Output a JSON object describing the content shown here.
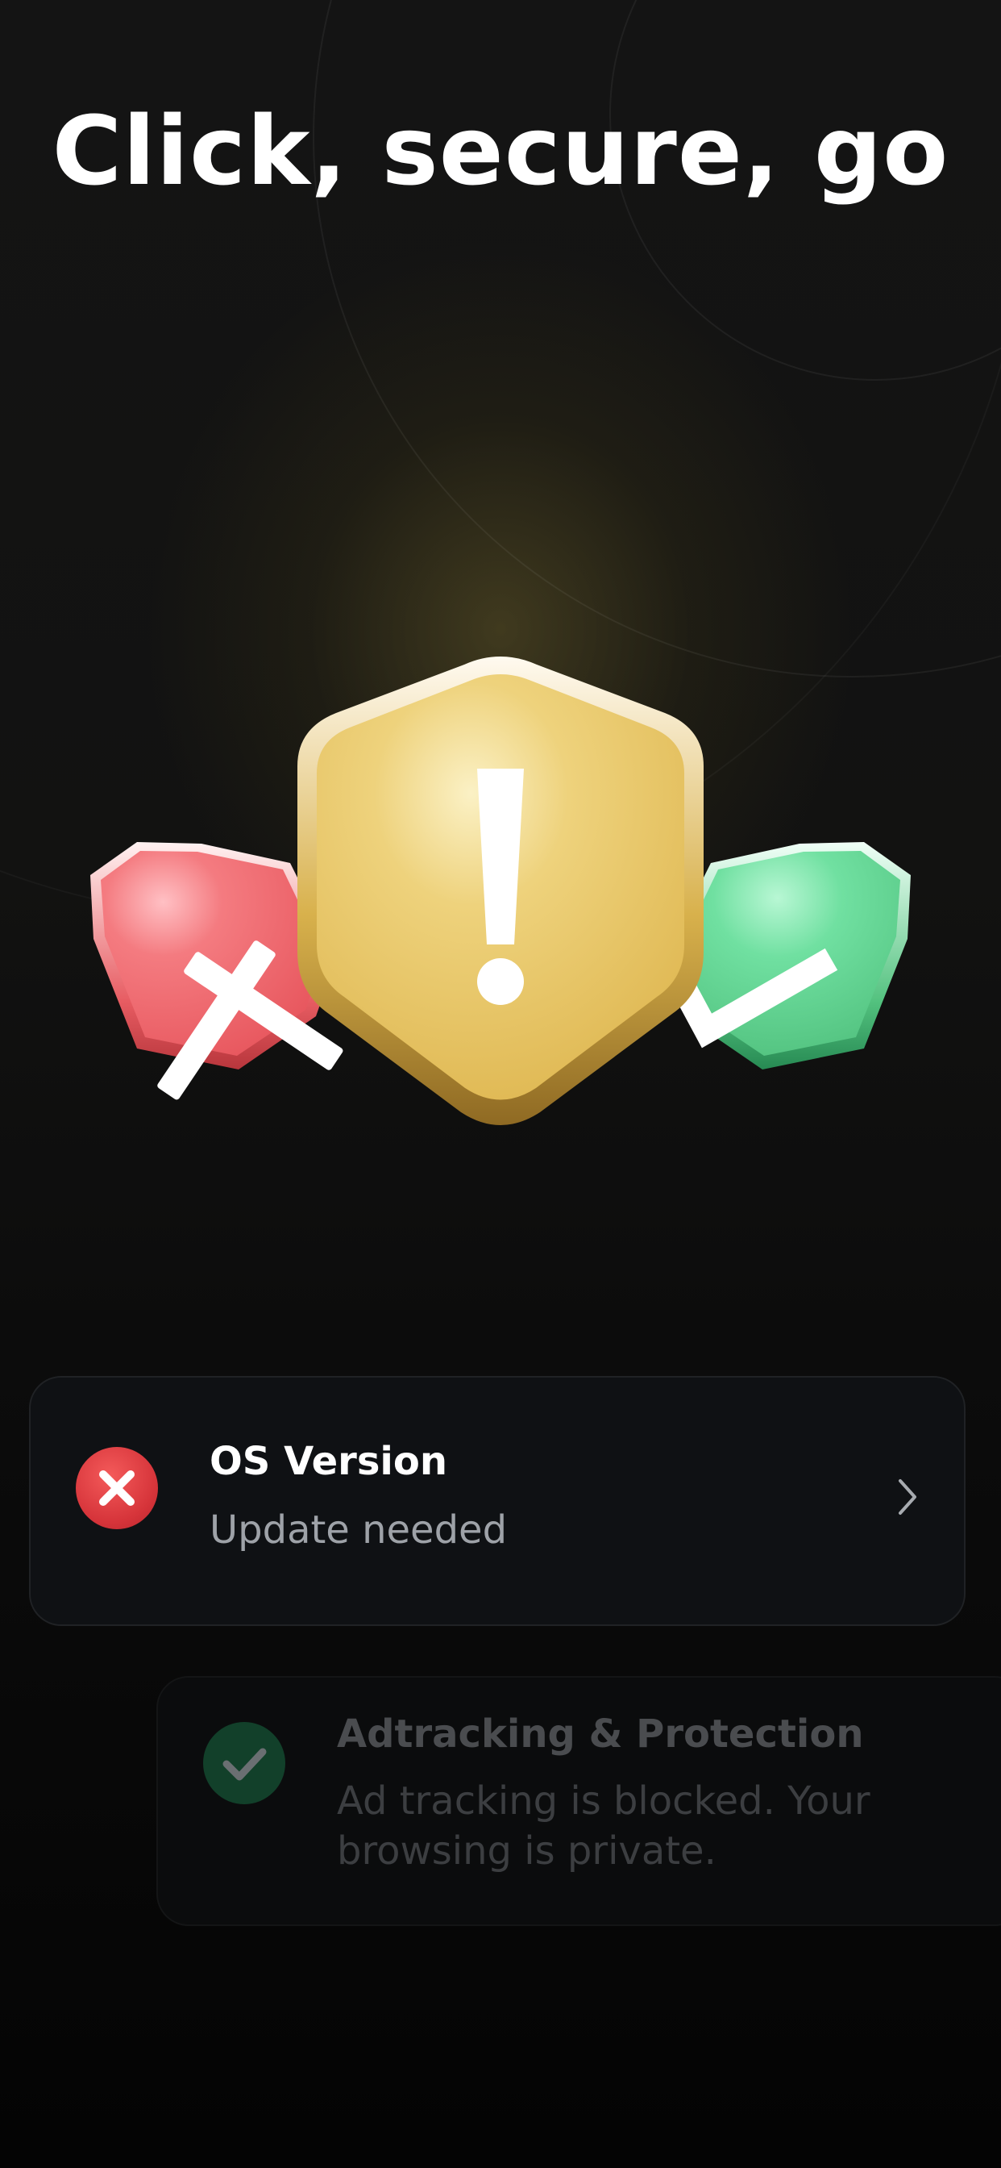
{
  "hero": {
    "title": "Click, secure, go"
  },
  "illustration": {
    "left_shield_icon": "x-shield-icon",
    "center_shield_icon": "exclamation-shield-icon",
    "right_shield_icon": "check-shield-icon",
    "colors": {
      "danger": "#ea5a61",
      "warning": "#e5bd58",
      "success": "#52cc85"
    }
  },
  "cards": [
    {
      "title": "OS Version",
      "status": "Update needed",
      "status_icon": "x-circle-icon",
      "status_color": "#d63a3f"
    },
    {
      "title": "Adtracking & Protection",
      "status": "Ad tracking is blocked. Your browsing is private.",
      "status_icon": "check-circle-icon",
      "status_color": "#12402a"
    }
  ]
}
